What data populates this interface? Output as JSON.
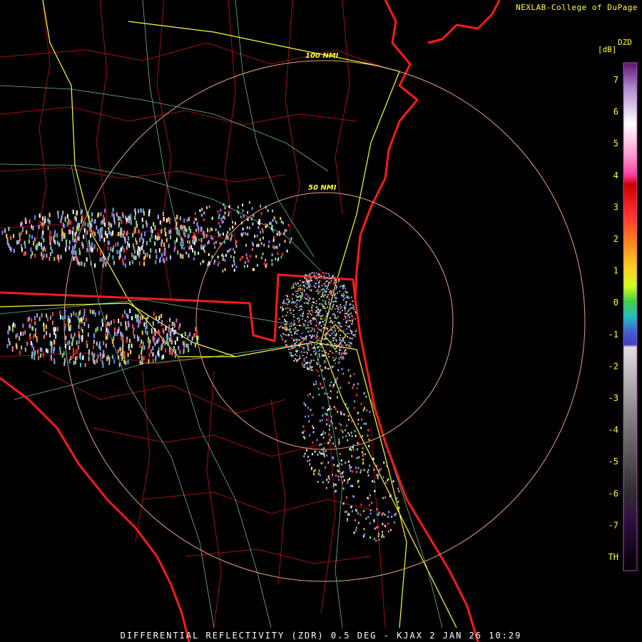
{
  "header": {
    "credit": "NEXLAB-College of DuPage"
  },
  "colorbar": {
    "product": "DZD",
    "units": "[dB]",
    "ticks": [
      "7",
      "6",
      "5",
      "4",
      "3",
      "2",
      "1",
      "0",
      "-1",
      "-2",
      "-3",
      "-4",
      "-5",
      "-6",
      "-7",
      "TH"
    ]
  },
  "range_rings": [
    {
      "label": "100 NMI"
    },
    {
      "label": "50 NMI"
    }
  ],
  "footer": {
    "caption": "DIFFERENTIAL REFLECTIVITY (ZDR) 0.5 DEG - KJAX 2 JAN 26 10:29"
  },
  "colors": {
    "background": "#000000",
    "coastline": "#ff1a1a",
    "county_lines": "#a01010",
    "highways": "#ffff33",
    "roads": "#7fd9a0",
    "range_rings": "#e8a080",
    "text": "#ffff33"
  }
}
